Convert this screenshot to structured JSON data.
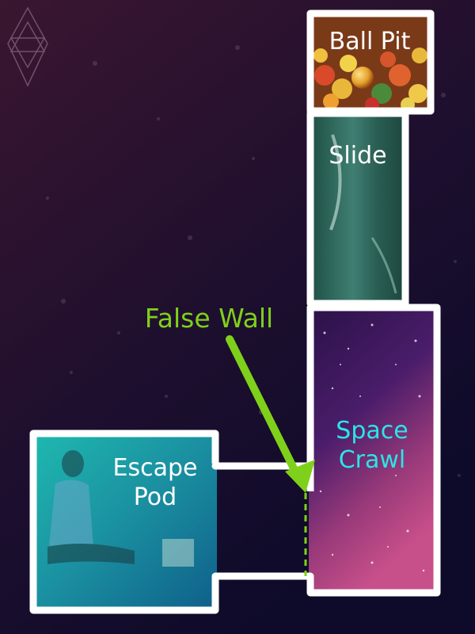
{
  "rooms": {
    "ball_pit": {
      "label": "Ball Pit"
    },
    "slide": {
      "label": "Slide"
    },
    "space_crawl": {
      "label_line1": "Space",
      "label_line2": "Crawl"
    },
    "escape_pod": {
      "label_line1": "Escape",
      "label_line2": "Pod"
    }
  },
  "annotation": {
    "label": "False Wall"
  },
  "colors": {
    "background_top": "#3a1630",
    "background_bottom": "#0d0a2a",
    "outline": "#ffffff",
    "annotation": "#7fd01a",
    "space_crawl_label": "#29e6e8",
    "room_label": "#ffffff"
  },
  "icons": {
    "corner_logo": "hexagram-diamond-icon"
  }
}
